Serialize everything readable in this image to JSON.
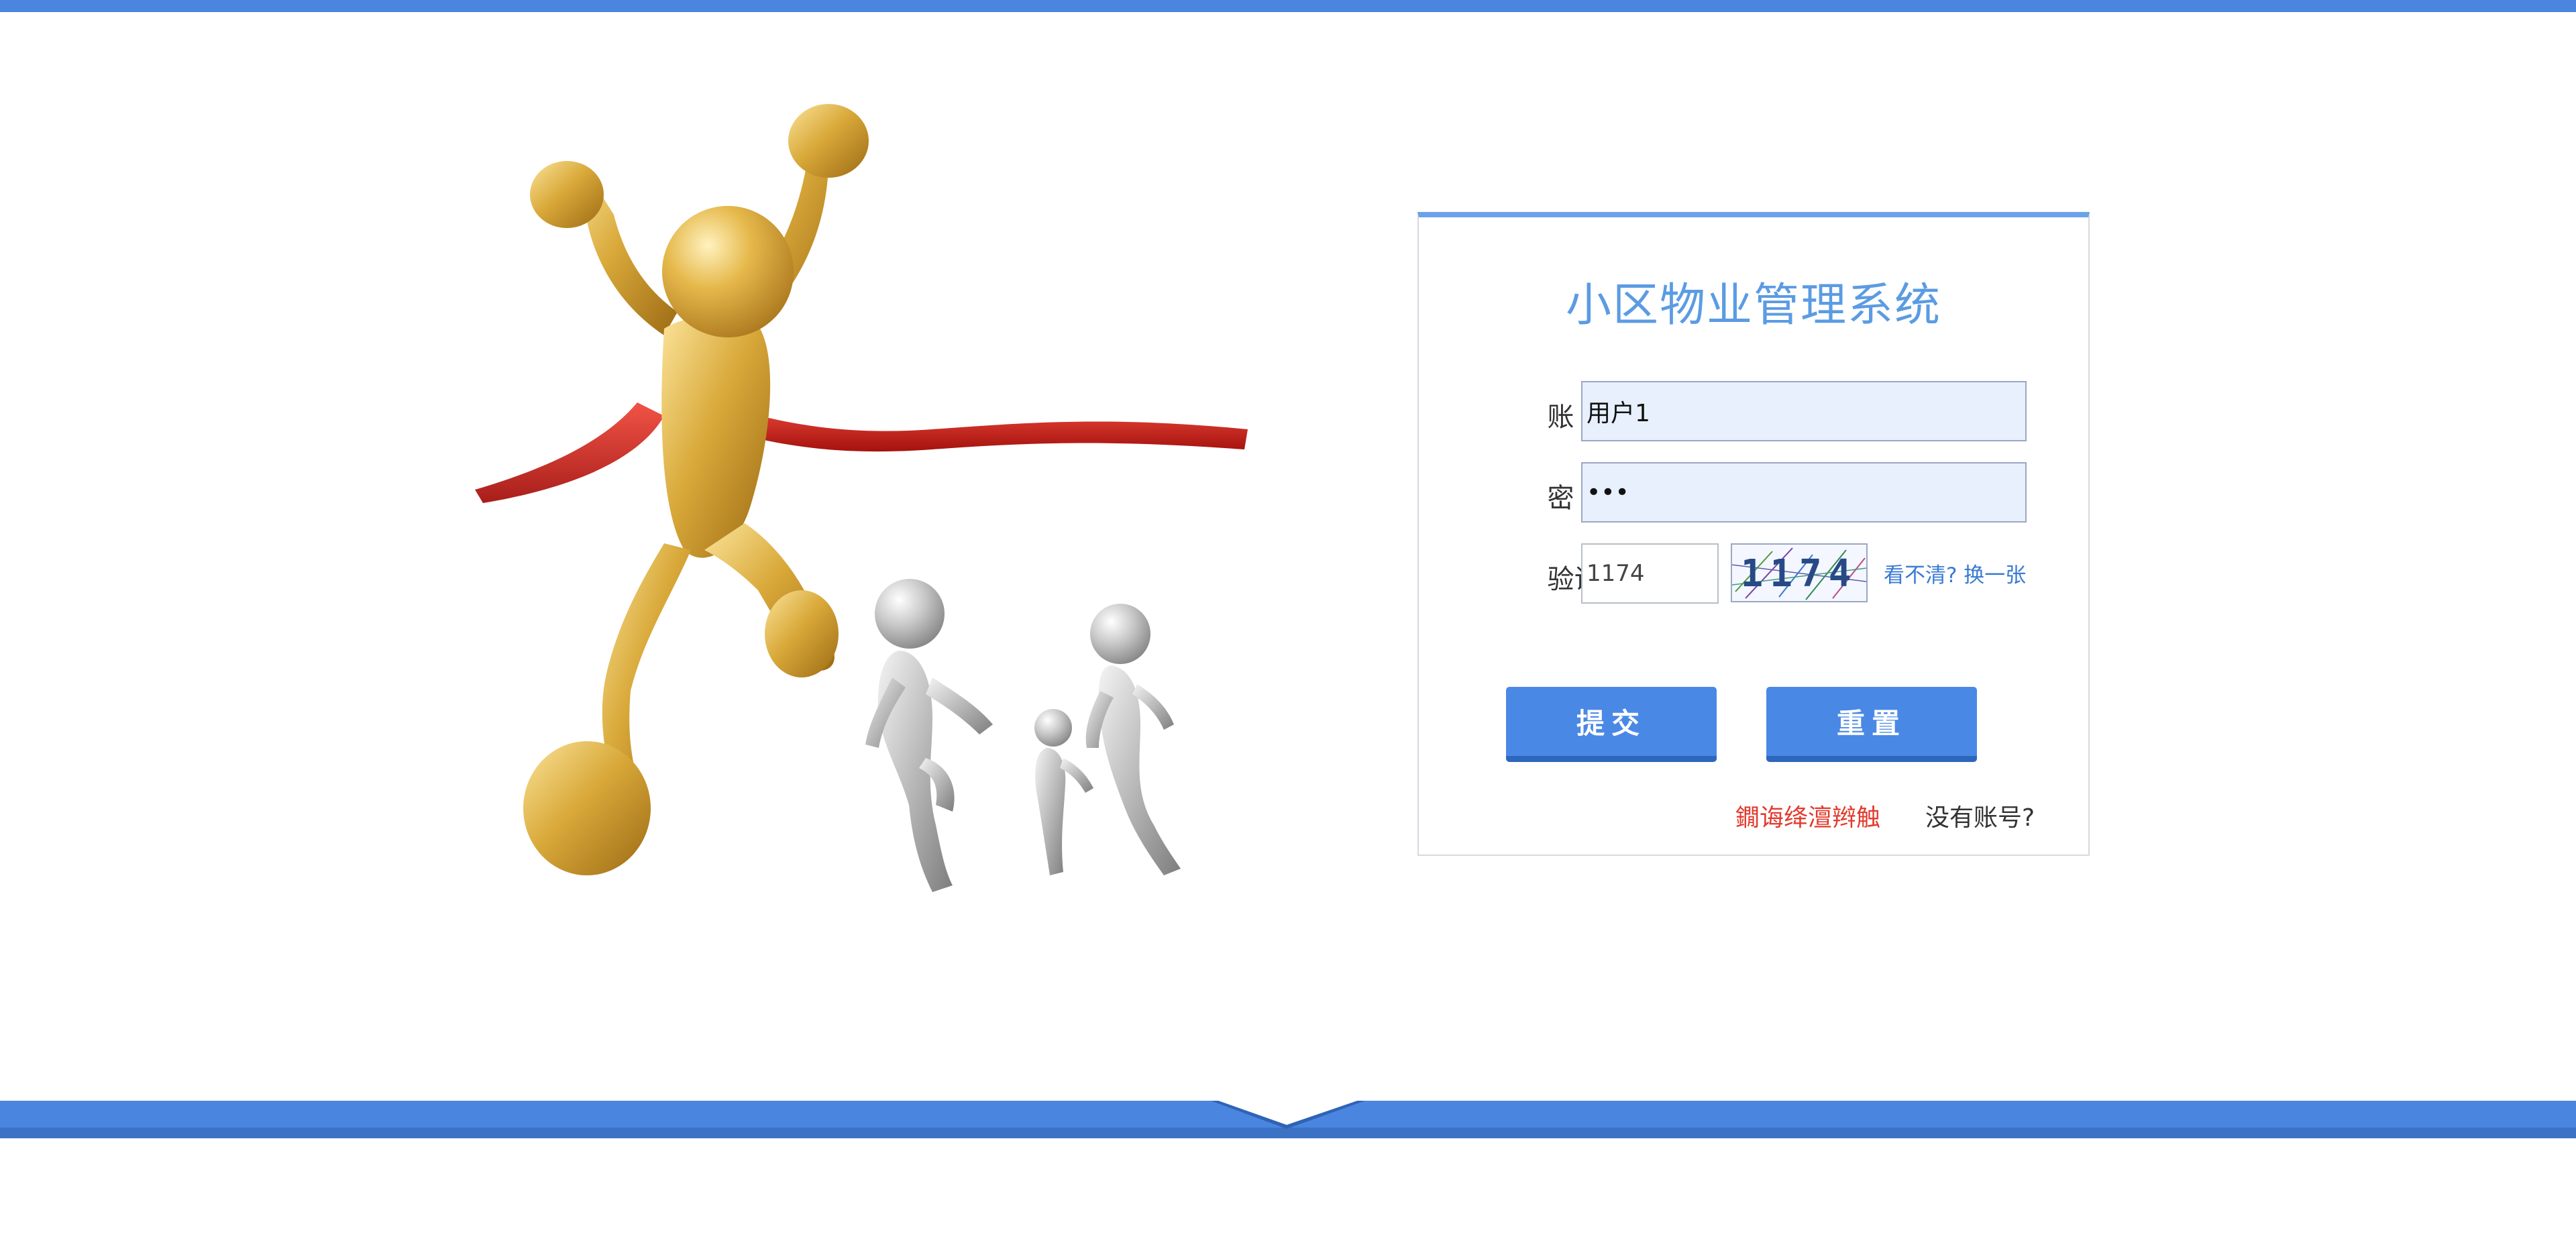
{
  "login": {
    "title": "小区物业管理系统",
    "account_label": "账　号:",
    "account_value": "用户1",
    "password_label": "密　码:",
    "password_value": "•••",
    "captcha_label": "验证码:",
    "captcha_input_value": "1174",
    "captcha_image_text": "1174",
    "captcha_refresh_text": "看不清? 换一张",
    "submit_label": "提交",
    "reset_label": "重置",
    "garbled_link_text": "鐗诲绛澶辫触",
    "register_link_text": "没有账号?"
  },
  "colors": {
    "accent_blue": "#4a86e0",
    "title_blue": "#5b9be3",
    "link_red": "#e23b2e",
    "input_fill": "#e8f0fe",
    "gold": "#d9a93a",
    "silver": "#b9b9b9",
    "ribbon_red": "#d3251f"
  },
  "illustration": {
    "icon": "winner-finish-line-illustration"
  }
}
